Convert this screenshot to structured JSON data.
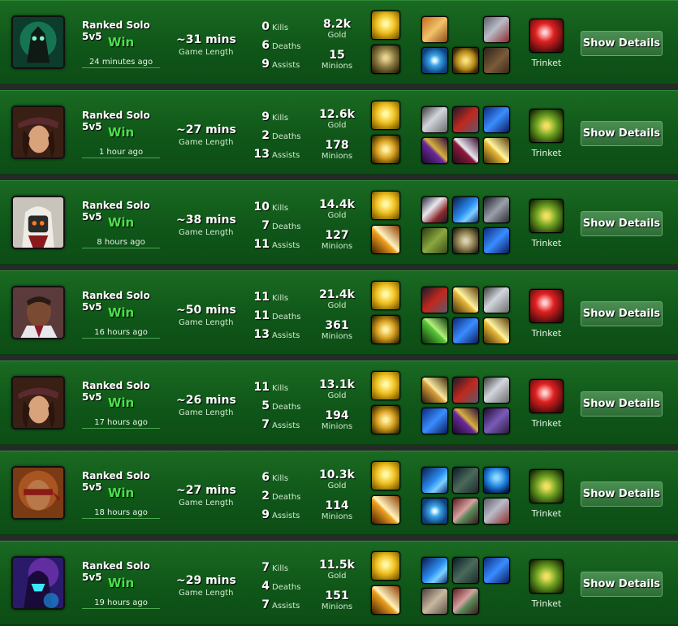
{
  "labels": {
    "game_length": "Game Length",
    "kills": "Kills",
    "deaths": "Deaths",
    "assists": "Assists",
    "gold": "Gold",
    "minions": "Minions",
    "trinket": "Trinket",
    "details": "Show Details"
  },
  "matches": [
    {
      "mode": "Ranked Solo 5v5",
      "result": "Win",
      "ago": "24 minutes ago",
      "length": "~31 mins",
      "kills": "0",
      "deaths": "6",
      "assists": "9",
      "gold": "8.2k",
      "minions": "15",
      "champion_icon": "thresh-portrait-icon",
      "items": [
        "gold-cloak-item-icon",
        "",
        "armored-gauntlet-item-icon",
        "blue-eye-item-icon",
        "golden-orb-item-icon",
        "boots-item-icon"
      ],
      "spells": [
        "flash-spell-icon",
        "exhaust-spell-icon"
      ],
      "trinket": "red-lens-trinket-icon"
    },
    {
      "mode": "Ranked Solo 5v5",
      "result": "Win",
      "ago": "1 hour ago",
      "length": "~27 mins",
      "kills": "9",
      "deaths": "2",
      "assists": "13",
      "gold": "12.6k",
      "minions": "178",
      "champion_icon": "caitlyn-portrait-icon",
      "items": [
        "silver-gauntlet-item-icon",
        "red-blade-item-icon",
        "blue-shard-item-icon",
        "purple-blade-item-icon",
        "red-sword-item-icon",
        "golden-staff-item-icon"
      ],
      "spells": [
        "flash-spell-icon",
        "heal-spell-icon"
      ],
      "trinket": "green-totem-trinket-icon"
    },
    {
      "mode": "Ranked Solo 5v5",
      "result": "Win",
      "ago": "8 hours ago",
      "length": "~38 mins",
      "kills": "10",
      "deaths": "7",
      "assists": "11",
      "gold": "14.4k",
      "minions": "127",
      "champion_icon": "master-yi-portrait-icon",
      "items": [
        "tome-item-icon",
        "blue-wave-item-icon",
        "armor-plate-item-icon",
        "green-hat-item-icon",
        "gold-rune-item-icon",
        "blue-shard-item-icon"
      ],
      "spells": [
        "flash-spell-icon",
        "smite-spell-icon"
      ],
      "trinket": "green-totem-trinket-icon"
    },
    {
      "mode": "Ranked Solo 5v5",
      "result": "Win",
      "ago": "16 hours ago",
      "length": "~50 mins",
      "kills": "11",
      "deaths": "11",
      "assists": "13",
      "gold": "21.4k",
      "minions": "361",
      "champion_icon": "lucian-portrait-icon",
      "items": [
        "red-blade-item-icon",
        "golden-staff-item-icon",
        "silver-gauntlet-item-icon",
        "green-blade-item-icon",
        "blue-shard-item-icon",
        "golden-staff-item-icon"
      ],
      "spells": [
        "flash-spell-icon",
        "heal-spell-icon"
      ],
      "trinket": "red-lens-trinket-icon"
    },
    {
      "mode": "Ranked Solo 5v5",
      "result": "Win",
      "ago": "17 hours ago",
      "length": "~26 mins",
      "kills": "11",
      "deaths": "5",
      "assists": "7",
      "gold": "13.1k",
      "minions": "194",
      "champion_icon": "caitlyn-portrait-icon",
      "items": [
        "gold-sword-item-icon",
        "red-blade-item-icon",
        "silver-gauntlet-item-icon",
        "blue-shard-item-icon",
        "purple-blade-item-icon",
        "purple-boots-item-icon"
      ],
      "spells": [
        "flash-spell-icon",
        "heal-spell-icon"
      ],
      "trinket": "red-lens-trinket-icon"
    },
    {
      "mode": "Ranked Solo 5v5",
      "result": "Win",
      "ago": "18 hours ago",
      "length": "~27 mins",
      "kills": "6",
      "deaths": "2",
      "assists": "9",
      "gold": "10.3k",
      "minions": "114",
      "champion_icon": "lee-sin-portrait-icon",
      "items": [
        "blue-wave-item-icon",
        "dark-boots-item-icon",
        "blue-helm-item-icon",
        "blue-eye-item-icon",
        "red-rune-item-icon",
        "armored-gauntlet-item-icon"
      ],
      "spells": [
        "flash-spell-icon",
        "smite-spell-icon"
      ],
      "trinket": "green-totem-trinket-icon"
    },
    {
      "mode": "Ranked Solo 5v5",
      "result": "Win",
      "ago": "19 hours ago",
      "length": "~29 mins",
      "kills": "7",
      "deaths": "4",
      "assists": "7",
      "gold": "11.5k",
      "minions": "151",
      "champion_icon": "kassadin-portrait-icon",
      "items": [
        "blue-wave-item-icon",
        "dark-boots-item-icon",
        "blue-shard-item-icon",
        "silver-cape-item-icon",
        "red-rune-item-icon",
        ""
      ],
      "spells": [
        "flash-spell-icon",
        "smite-spell-icon"
      ],
      "trinket": "green-totem-trinket-icon"
    }
  ]
}
